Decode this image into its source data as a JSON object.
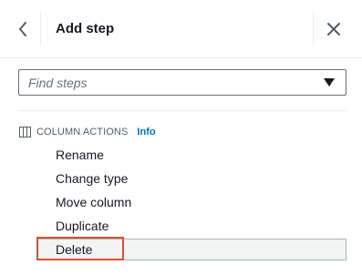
{
  "header": {
    "title": "Add step",
    "back_icon": "chevron-left-icon",
    "close_icon": "close-icon"
  },
  "search": {
    "placeholder": "Find steps",
    "value": "",
    "dropdown_icon": "caret-down-icon"
  },
  "section": {
    "label": "COLUMN ACTIONS",
    "info_link": "Info",
    "icon": "columns-icon"
  },
  "actions": [
    {
      "label": "Rename"
    },
    {
      "label": "Change type"
    },
    {
      "label": "Move column"
    },
    {
      "label": "Duplicate"
    },
    {
      "label": "Delete",
      "selected": true
    }
  ],
  "colors": {
    "link": "#0073bb",
    "highlight": "#d9502b",
    "selected_bg": "#f2f3f3"
  }
}
